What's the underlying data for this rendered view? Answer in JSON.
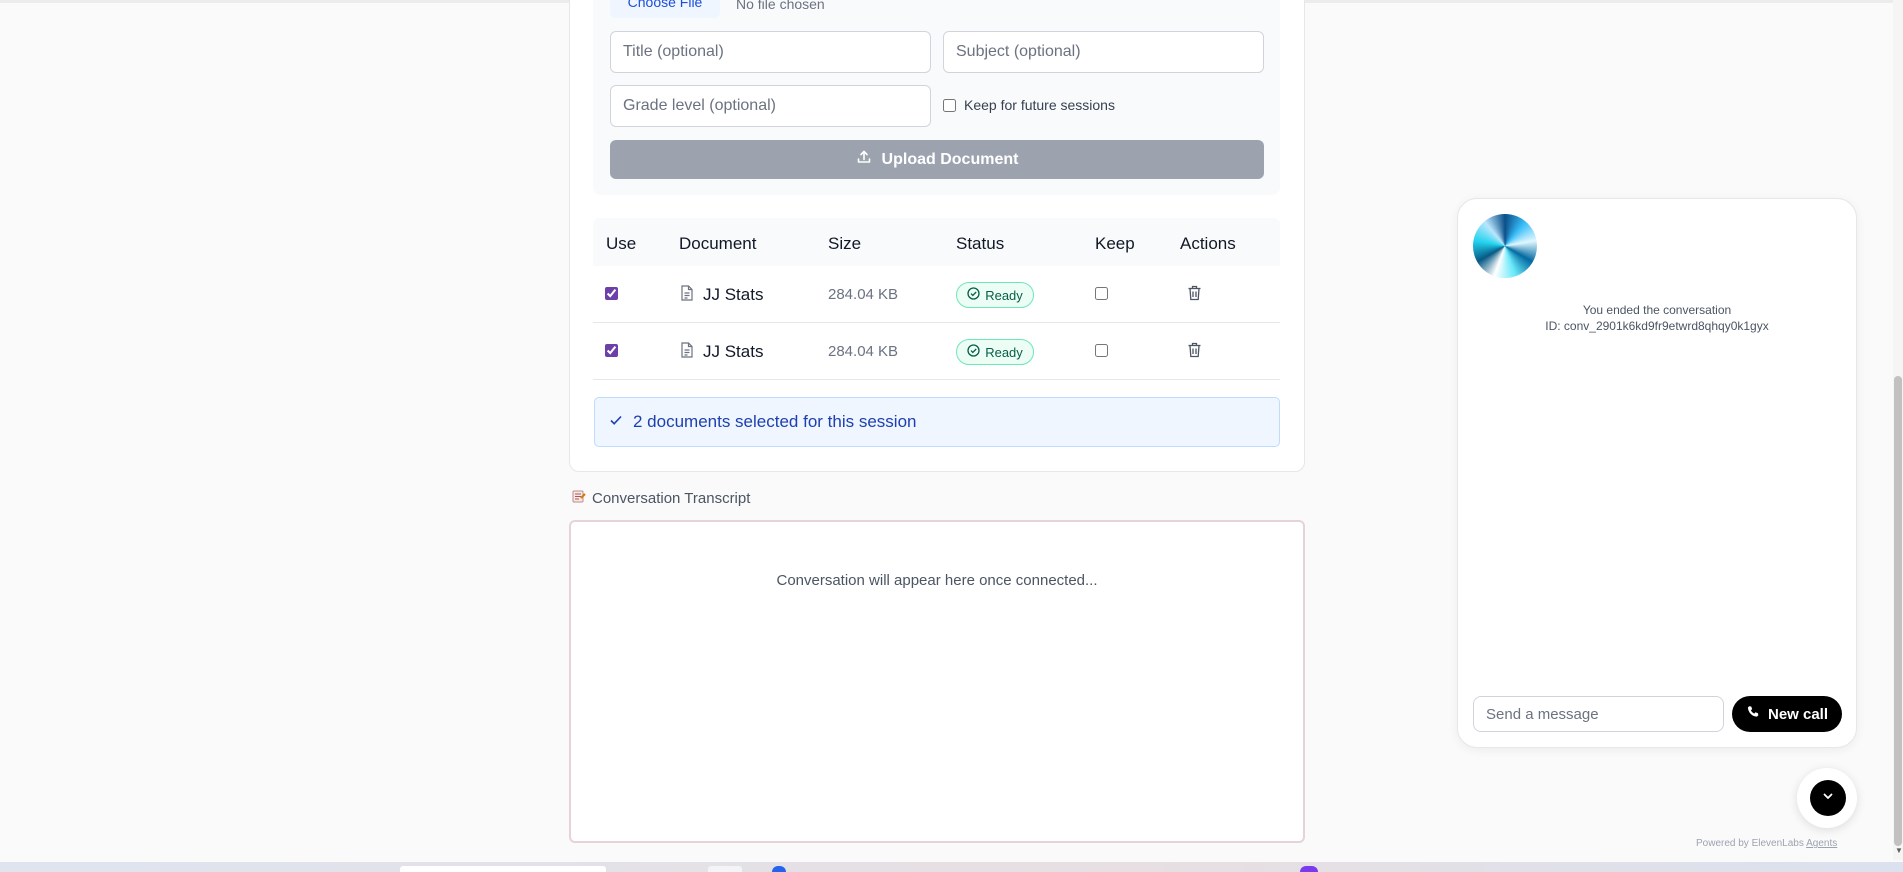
{
  "upload": {
    "choose_file_label": "Choose File",
    "no_file_text": "No file chosen",
    "title_placeholder": "Title (optional)",
    "subject_placeholder": "Subject (optional)",
    "grade_placeholder": "Grade level (optional)",
    "keep_label": "Keep for future sessions",
    "upload_button_label": "Upload Document"
  },
  "table": {
    "headers": {
      "use": "Use",
      "document": "Document",
      "size": "Size",
      "status": "Status",
      "keep": "Keep",
      "actions": "Actions"
    },
    "rows": [
      {
        "use": true,
        "name": "JJ Stats",
        "size": "284.04 KB",
        "status": "Ready",
        "keep": false
      },
      {
        "use": true,
        "name": "JJ Stats",
        "size": "284.04 KB",
        "status": "Ready",
        "keep": false
      }
    ]
  },
  "selection_info": "2 documents selected for this session",
  "transcript": {
    "label": "Conversation Transcript",
    "empty_text": "Conversation will appear here once connected..."
  },
  "widget": {
    "ended_text": "You ended the conversation",
    "conversation_id": "ID: conv_2901k6kd9fr9etwrd8qhqy0k1gyx",
    "message_placeholder": "Send a message",
    "new_call_label": "New call",
    "powered_by": "Powered by ElevenLabs",
    "powered_link": "Agents"
  },
  "colors": {
    "accent_purple": "#6d3fa8",
    "ready_green": "#065f46",
    "info_blue": "#1e40af",
    "upload_disabled": "#9ca3af"
  }
}
